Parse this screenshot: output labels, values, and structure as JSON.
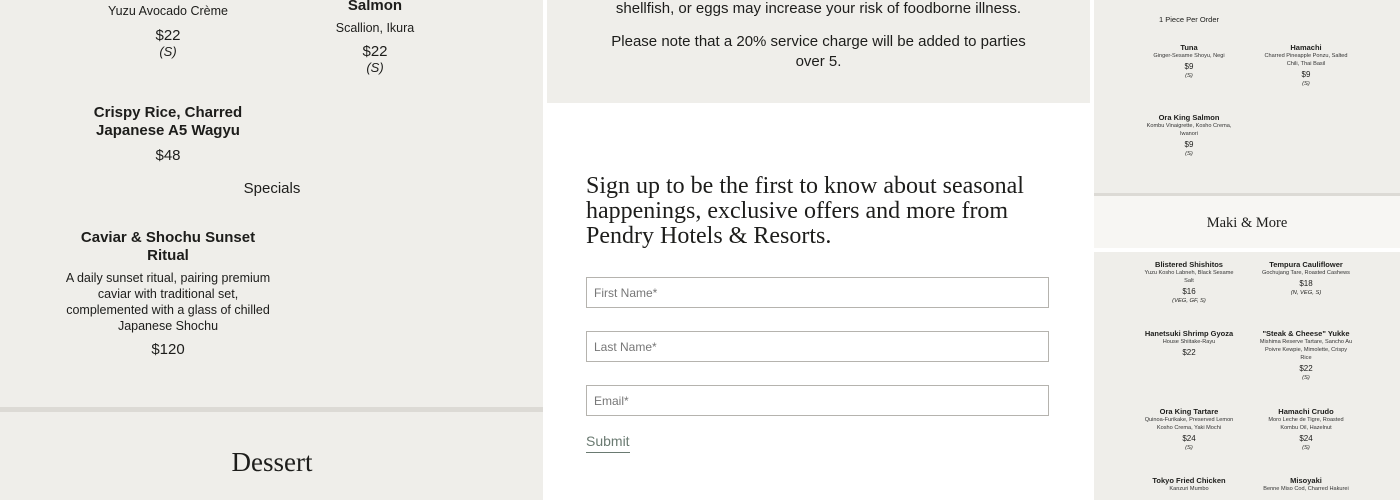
{
  "left": {
    "top_items": [
      {
        "desc": "Yuzu Avocado Crème",
        "price": "$22",
        "tag": "(S)"
      },
      {
        "name": "Salmon",
        "desc": "Scallion, Ikura",
        "price": "$22",
        "tag": "(S)"
      }
    ],
    "crispy_rice": {
      "name_line1": "Crispy Rice, Charred",
      "name_line2": "Japanese A5 Wagyu",
      "price": "$48"
    },
    "specials_label": "Specials",
    "caviar": {
      "name_line1": "Caviar & Shochu Sunset",
      "name_line2": "Ritual",
      "desc_lines": [
        "A daily sunset ritual, pairing premium",
        "caviar with traditional set,",
        "complemented with a glass of chilled",
        "Japanese Shochu"
      ],
      "price": "$120"
    },
    "dessert_title": "Dessert"
  },
  "center": {
    "notice_line1": "shellfish, or eggs may increase your risk of foodborne illness.",
    "notice_line2": "Please note that a 20% service charge will be added to parties",
    "notice_line3": "over 5.",
    "signup_heading": "Sign up to be the first to know about seasonal happenings, exclusive offers and more from Pendry Hotels & Resorts.",
    "fields": {
      "first_name_placeholder": "First Name*",
      "last_name_placeholder": "Last Name*",
      "email_placeholder": "Email*"
    },
    "submit_label": "Submit"
  },
  "right": {
    "piece_note": "1 Piece Per Order",
    "nigiri": [
      {
        "name": "Tuna",
        "desc": [
          "Ginger-Sesame Shoyu, Negi"
        ],
        "price": "$9",
        "tag": "(S)"
      },
      {
        "name": "Hamachi",
        "desc": [
          "Charred Pineapple Ponzu, Salted",
          "Chili, Thai Basil"
        ],
        "price": "$9",
        "tag": "(S)"
      },
      {
        "name": "Ora King Salmon",
        "desc": [
          "Kombu Vinaigrette, Kosho Crema,",
          "Iwanori"
        ],
        "price": "$9",
        "tag": "(S)"
      }
    ],
    "maki_title": "Maki & More",
    "maki": [
      {
        "name": "Blistered Shishitos",
        "desc": [
          "Yuzu Kosho Labneh, Black Sesame",
          "Salt"
        ],
        "price": "$16",
        "tag": "(VEG, GF, S)"
      },
      {
        "name": "Tempura Cauliflower",
        "desc": [
          "Gochujang Tare, Roasted Cashews"
        ],
        "price": "$18",
        "tag": "(N, VEG, S)"
      },
      {
        "name": "Hanetsuki Shrimp Gyoza",
        "desc": [
          "House Shiitake-Rayu"
        ],
        "price": "$22",
        "tag": ""
      },
      {
        "name": "\"Steak & Cheese\" Yukke",
        "desc": [
          "Mishima Reserve Tartare, Sancho Au",
          "Poivre Kewpie, Mimolette, Crispy",
          "Rice"
        ],
        "price": "$22",
        "tag": "(S)"
      },
      {
        "name": "Ora King Tartare",
        "desc": [
          "Quinoa-Furikake, Preserved Lemon",
          "Kosho Crema, Yaki Mochi"
        ],
        "price": "$24",
        "tag": "(S)"
      },
      {
        "name": "Hamachi Crudo",
        "desc": [
          "Moro Leche de Tigre, Roasted",
          "Kombu Oil, Hazelnut"
        ],
        "price": "$24",
        "tag": "(S)"
      },
      {
        "name": "Tokyo Fried Chicken",
        "desc": [
          "Kanzuri Mumbo"
        ],
        "price": "",
        "tag": ""
      },
      {
        "name": "Misoyaki",
        "desc": [
          "Benne Miso Cod, Charred Hakurei"
        ],
        "price": "",
        "tag": ""
      }
    ]
  }
}
